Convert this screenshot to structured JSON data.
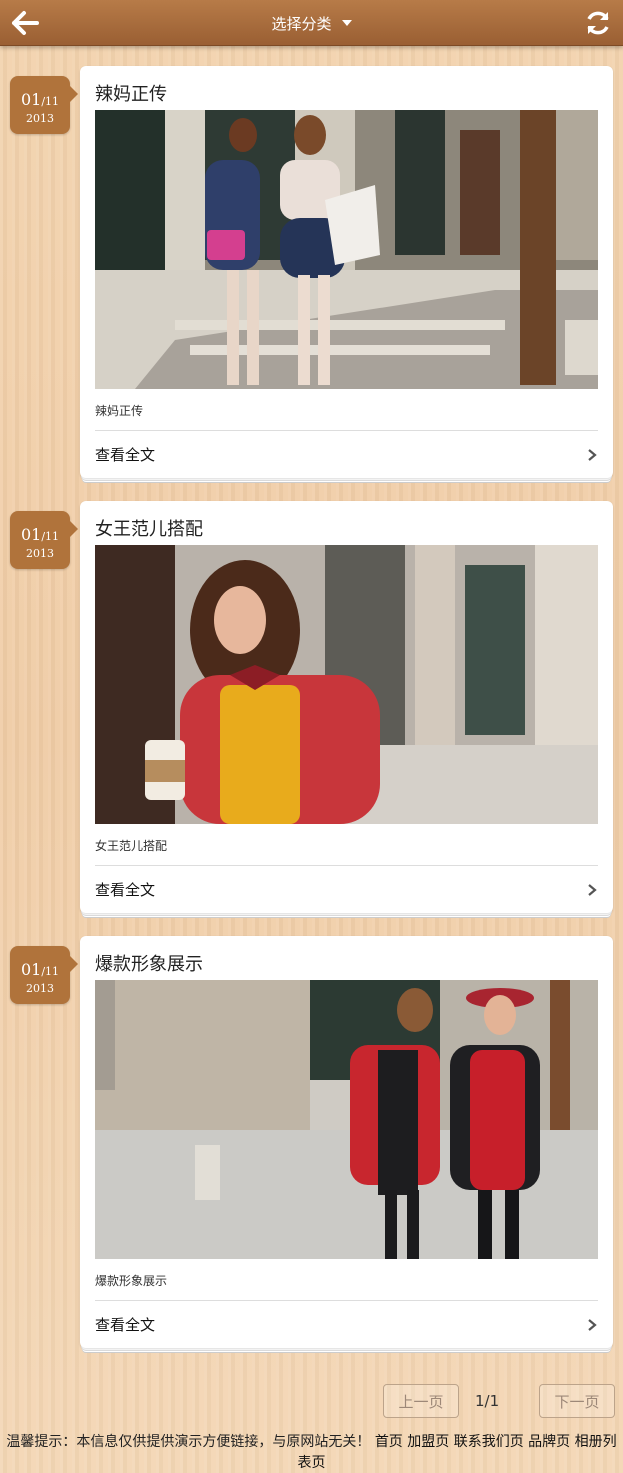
{
  "header": {
    "title": "选择分类",
    "icons": {
      "back": "arrow-left-icon",
      "refresh": "refresh-icon",
      "caret": "caret-down-icon"
    }
  },
  "posts": [
    {
      "date_md": "01",
      "date_month": "/11",
      "year": "2013",
      "title": "辣妈正传",
      "image": "two-women-walking-street-photo",
      "desc": "辣妈正传",
      "link": "查看全文"
    },
    {
      "date_md": "01",
      "date_month": "/11",
      "year": "2013",
      "title": "女王范儿搭配",
      "image": "woman-red-jacket-coffee-photo",
      "desc": "女王范儿搭配",
      "link": "查看全文"
    },
    {
      "date_md": "01",
      "date_month": "/11",
      "year": "2013",
      "title": "爆款形象展示",
      "image": "two-women-red-outfits-photo",
      "desc": "爆款形象展示",
      "link": "查看全文"
    }
  ],
  "pager": {
    "prev": "上一页",
    "page": "1/1",
    "next": "下一页"
  },
  "footer": {
    "notice": "温馨提示：本信息仅供提供演示方便链接，与原网站无关！",
    "links": [
      "首页",
      "加盟页",
      "联系我们页",
      "品牌页",
      "相册列表页"
    ]
  },
  "colors": {
    "header": "#a6693b",
    "badge": "#b0733b",
    "background": "#f0cfa8"
  }
}
